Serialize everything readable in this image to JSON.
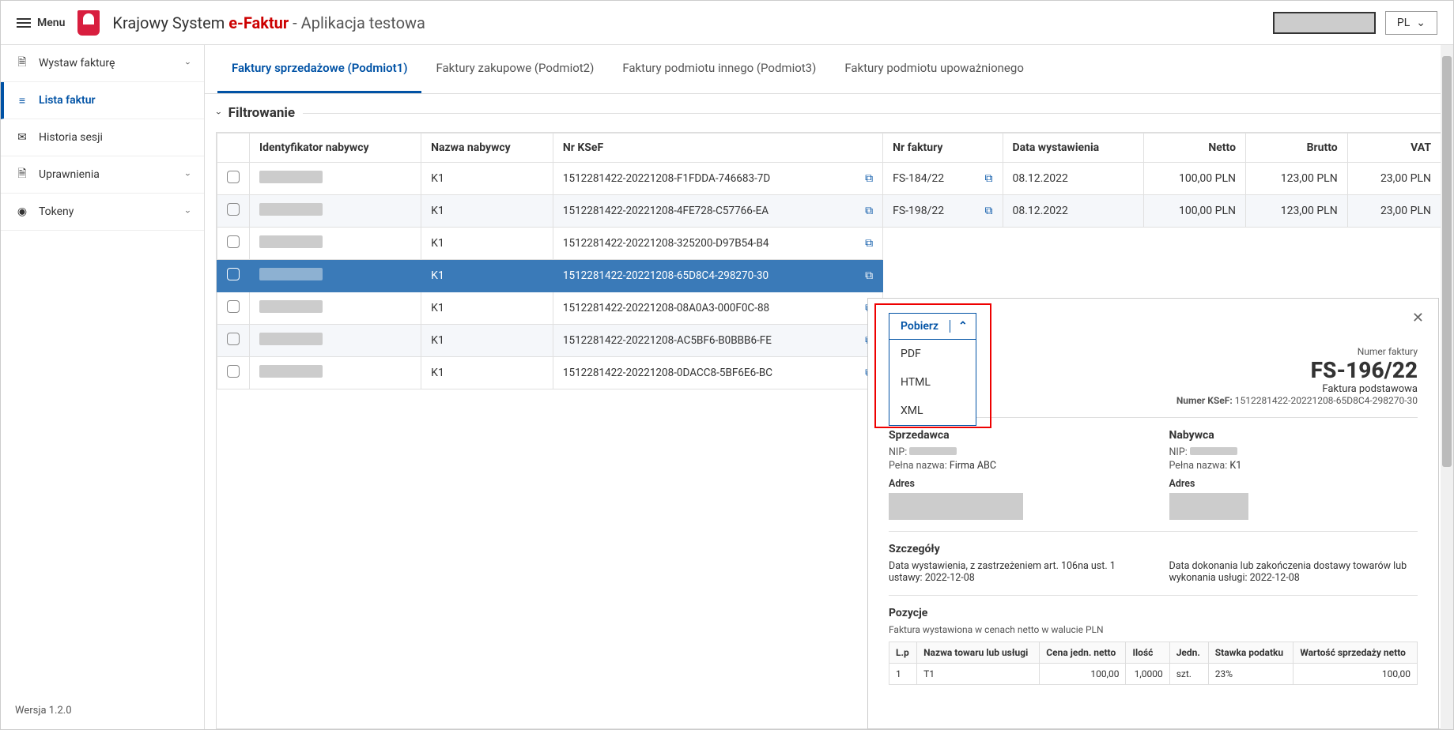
{
  "header": {
    "menu_label": "Menu",
    "brand_prefix": "Krajowy System ",
    "brand_ef": "e-Faktur",
    "brand_suffix": " - Aplikacja testowa",
    "lang": "PL"
  },
  "sidebar": {
    "items": [
      {
        "label": "Wystaw fakturę",
        "icon": "document-icon",
        "expand": true
      },
      {
        "label": "Lista faktur",
        "icon": "list-icon",
        "active": true
      },
      {
        "label": "Historia sesji",
        "icon": "mail-icon"
      },
      {
        "label": "Uprawnienia",
        "icon": "file-icon",
        "expand": true
      },
      {
        "label": "Tokeny",
        "icon": "disc-icon",
        "expand": true
      }
    ],
    "version": "Wersja 1.2.0"
  },
  "tabs": [
    {
      "label": "Faktury sprzedażowe (Podmiot1)",
      "active": true
    },
    {
      "label": "Faktury zakupowe (Podmiot2)"
    },
    {
      "label": "Faktury podmiotu innego (Podmiot3)"
    },
    {
      "label": "Faktury podmiotu upoważnionego"
    }
  ],
  "filter_label": "Filtrowanie",
  "columns": {
    "buyer_id": "Identyfikator nabywcy",
    "buyer_name": "Nazwa nabywcy",
    "ksef": "Nr KSeF",
    "inv_no": "Nr faktury",
    "issue_date": "Data wystawienia",
    "net": "Netto",
    "gross": "Brutto",
    "vat": "VAT"
  },
  "rows": [
    {
      "buyer_name": "K1",
      "ksef": "1512281422-20221208-F1FDDA-746683-7D",
      "inv_no": "FS-184/22",
      "date": "08.12.2022",
      "net": "100,00 PLN",
      "gross": "123,00 PLN",
      "vat": "23,00 PLN"
    },
    {
      "buyer_name": "K1",
      "ksef": "1512281422-20221208-4FE728-C57766-EA",
      "inv_no": "FS-198/22",
      "date": "08.12.2022",
      "net": "100,00 PLN",
      "gross": "123,00 PLN",
      "vat": "23,00 PLN"
    },
    {
      "buyer_name": "K1",
      "ksef": "1512281422-20221208-325200-D97B54-B4"
    },
    {
      "buyer_name": "K1",
      "ksef": "1512281422-20221208-65D8C4-298270-30",
      "selected": true
    },
    {
      "buyer_name": "K1",
      "ksef": "1512281422-20221208-08A0A3-000F0C-88"
    },
    {
      "buyer_name": "K1",
      "ksef": "1512281422-20221208-AC5BF6-B0BBB6-FE"
    },
    {
      "buyer_name": "K1",
      "ksef": "1512281422-20221208-0DACC8-5BF6E6-BC"
    }
  ],
  "details": {
    "download_label": "Pobierz",
    "download_options": [
      "PDF",
      "HTML",
      "XML"
    ],
    "num_label": "Numer faktury",
    "number": "FS-196/22",
    "type": "Faktura podstawowa",
    "ksef_label": "Numer KSeF:",
    "ksef": "1512281422-20221208-65D8C4-298270-30",
    "seller_title": "Sprzedawca",
    "buyer_title": "Nabywca",
    "nip_label": "NIP:",
    "fullname_label": "Pełna nazwa:",
    "seller_name": "Firma ABC",
    "buyer_name": "K1",
    "address_label": "Adres",
    "details_title": "Szczegóły",
    "issue_text": "Data wystawienia, z zastrzeżeniem art. 106na ust. 1 ustawy:",
    "issue_date": "2022-12-08",
    "delivery_text": "Data dokonania lub zakończenia dostawy towarów lub wykonania usługi:",
    "delivery_date": "2022-12-08",
    "items_title": "Pozycje",
    "items_note": "Faktura wystawiona w cenach netto w walucie PLN",
    "items_cols": {
      "lp": "L.p",
      "name": "Nazwa towaru lub usługi",
      "unit_price": "Cena jedn. netto",
      "qty": "Ilość",
      "unit": "Jedn.",
      "tax_rate": "Stawka podatku",
      "net_value": "Wartość sprzedaży netto"
    },
    "items": [
      {
        "lp": "1",
        "name": "T1",
        "unit_price": "100,00",
        "qty": "1,0000",
        "unit": "szt.",
        "tax_rate": "23%",
        "net_value": "100,00"
      }
    ]
  }
}
